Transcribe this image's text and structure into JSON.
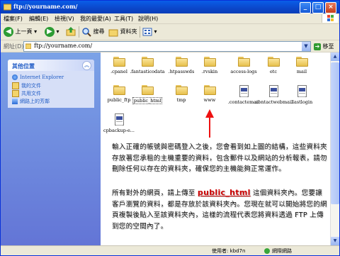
{
  "window": {
    "title": "ftp://yourname.com/"
  },
  "menu": [
    "檔案(F)",
    "編輯(E)",
    "檢視(V)",
    "我的最愛(A)",
    "工具(T)",
    "說明(H)"
  ],
  "toolbar": {
    "back": "上一頁",
    "search": "搜尋",
    "folders": "資料夾"
  },
  "address": {
    "label": "網址(D)",
    "value": "ftp://yourname.com/",
    "go": "移至"
  },
  "sidebar": {
    "title": "其他位置",
    "items": [
      "Internet Explorer",
      "我的文件",
      "共用文件",
      "網路上的芳鄰"
    ]
  },
  "files": [
    {
      "name": ".cpanel",
      "type": "folder"
    },
    {
      "name": ".fantasticodata",
      "type": "folder"
    },
    {
      "name": ".htpasswds",
      "type": "folder"
    },
    {
      "name": ".rvskin",
      "type": "folder"
    },
    {
      "name": "access-logs",
      "type": "folder"
    },
    {
      "name": "etc",
      "type": "folder"
    },
    {
      "name": "mail",
      "type": "folder"
    },
    {
      "name": "public_ftp",
      "type": "folder"
    },
    {
      "name": "public_html",
      "type": "folder"
    },
    {
      "name": "tmp",
      "type": "folder"
    },
    {
      "name": "www",
      "type": "folder"
    },
    {
      "name": ".contactemail",
      "type": "file"
    },
    {
      "name": ".contactwebmail",
      "type": "file"
    },
    {
      "name": ".lastlogin",
      "type": "file"
    },
    {
      "name": "cpbackup-e...",
      "type": "file"
    }
  ],
  "article": {
    "p1": "輸入正確的帳號與密碼登入之後，您會看到如上圖的結構，這些資料夾存放著您承租的主機重要的資料，包含郵件以及網站的分析報表，請勿刪除任何以存在的資料夾，確保您的主機能夠正常運作。",
    "p2_before": "所有對外的網頁，請上傳至 ",
    "p2_keyword": "public_html",
    "p2_after": " 這個資料夾內。您要讓客戶瀏覽的資料，都是存放於該資料夾內。您現在就可以開始將您的網頁複製後貼入至該資料夾內，這樣的流程代表您將資料透過 FTP 上傳到您的空間內了。"
  },
  "status": {
    "user": "使用者: kbd7n",
    "zone": "網際網路"
  },
  "colors": {
    "accent": "#c00",
    "titlebar": "#0a5ee8",
    "sidebar": "#7ba2e7"
  }
}
